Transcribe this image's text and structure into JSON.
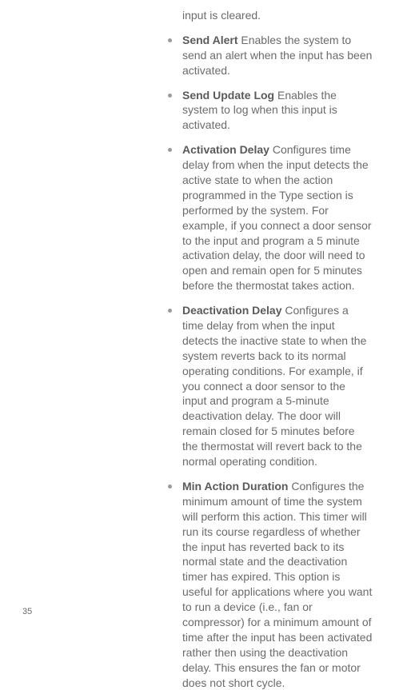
{
  "fragment": "input is cleared.",
  "items": [
    {
      "term": "Send Alert",
      "desc": "Enables the system to send an alert when the input has been activated."
    },
    {
      "term": "Send Update Log",
      "desc": "Enables the system to log when this input is activated."
    },
    {
      "term": "Activation Delay",
      "desc": "Configures time delay from when the input detects the active state to when the action programmed in the Type section is performed by the system. For example, if you connect a door sensor to the input and program a 5 minute activation delay, the door will need to open and remain open for 5 minutes before the thermostat takes action."
    },
    {
      "term": "Deactivation Delay",
      "desc": "Configures a time delay from when the input detects the inactive state to when the system reverts back to its normal operating conditions. For example, if you connect a door sensor to the input and program a 5-minute deactivation delay. The door will remain closed for 5 minutes before the thermostat will revert back to the normal operating condition."
    },
    {
      "term": "Min Action Duration",
      "desc": "Configures the minimum amount of time the system will perform this action. This timer will run its course regardless of whether the input has reverted back to its normal state and the deactivation timer has expired. This option is useful for applications where you want to run a device (i.e., fan or compressor) for a minimum amount of time after the input has been activated rather then using the deactivation delay. This ensures the fan or motor does not short cycle."
    }
  ],
  "page_number": "35"
}
